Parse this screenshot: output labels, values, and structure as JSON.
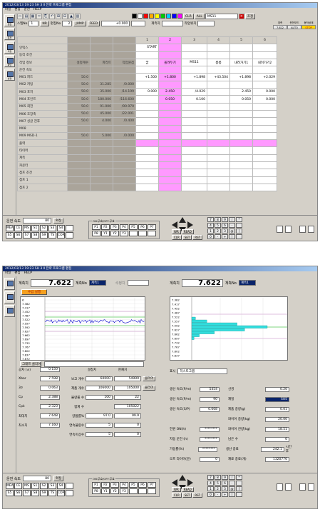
{
  "w1": {
    "title": "2012/03/13 19:23 SH 3 Ⅱ   전략 프로그램 편집",
    "menu": [
      "파일",
      "편집",
      "운전",
      "HELP"
    ],
    "side": [
      "편집",
      "운전",
      "티칭",
      "확인",
      "변경"
    ],
    "toolbar": {
      "clr": "CLR",
      "all": "ALL",
      "ms_select": "MS11",
      "confirm": "조정"
    },
    "row2": {
      "stepno_label": "스텝No",
      "stepno": "1",
      "nr": "NR",
      "pyeonjip_label": "편집No",
      "pyeonjip": "2",
      "jump": "JUMP",
      "feed": "FEED",
      "feed_val": "+0.000",
      "gyecheuk_label": "계측치",
      "jakeop_label": "작업위치"
    },
    "status": {
      "h1": "계측",
      "h2": "운전모드",
      "h3": "동작상태",
      "v1": "7.622",
      "v2": "AUTO",
      "v3": "STOP"
    },
    "left_headers": [
      "설정계수",
      "파라트",
      "작업원점"
    ],
    "col_numbers": [
      "1",
      "2",
      "3",
      "4",
      "5",
      "6"
    ],
    "rows": [
      {
        "label": "인덱스",
        "g": [
          "",
          "",
          ""
        ],
        "c": [
          "START",
          "",
          "",
          "",
          "",
          ""
        ]
      },
      {
        "label": "동작 조건",
        "g": [
          "",
          "",
          ""
        ],
        "c": [
          "",
          "",
          "",
          "",
          "",
          ""
        ]
      },
      {
        "label": "작업 정보",
        "g": [
          "설정계수",
          "파라트",
          "작업원점"
        ],
        "c": [
          "꿈",
          "올려두기",
          "MS11",
          "롱롱",
          "내려가기1",
          "내려가기2"
        ]
      },
      {
        "label": "운전 속도",
        "g": [
          "",
          "",
          ""
        ],
        "c": [
          "",
          "",
          "",
          "",
          "",
          ""
        ]
      },
      {
        "label": "M01 피드",
        "g": [
          "50.0",
          "",
          ""
        ],
        "c": [
          "+1.500",
          "+1.800",
          "+1.898",
          "+43.504",
          "+1.898",
          "+2.029"
        ]
      },
      {
        "label": "M02 커팅",
        "g": [
          "50.0",
          "31.285",
          "/0.000"
        ],
        "c": [
          "",
          "",
          "",
          "",
          "",
          ""
        ]
      },
      {
        "label": "M03 포지",
        "g": [
          "50.0",
          "35.000",
          "/14.199"
        ],
        "c": [
          "0.000",
          "2.450",
          "/4.029",
          "",
          "2.450",
          "0.000"
        ]
      },
      {
        "label": "M04 포인트",
        "g": [
          "50.0",
          "180.000",
          "/116.600"
        ],
        "c": [
          "",
          "0.050",
          "0.100",
          "",
          "0.050",
          "0.000"
        ]
      },
      {
        "label": "M05 회전",
        "g": [
          "50.0",
          "91.000",
          "/90.970"
        ],
        "c": [
          "",
          "",
          "",
          "",
          "",
          ""
        ]
      },
      {
        "label": "M06 호장축",
        "g": [
          "50.0",
          "45.000",
          "/22.001"
        ],
        "c": [
          "",
          "",
          "",
          "",
          "",
          ""
        ]
      },
      {
        "label": "M07 싱글 전후",
        "g": [
          "50.0",
          "4.000",
          "/0.400"
        ],
        "c": [
          "",
          "",
          "",
          "",
          "",
          ""
        ]
      },
      {
        "label": "M08",
        "g": [
          "",
          "",
          ""
        ],
        "c": [
          "",
          "",
          "",
          "",
          "",
          ""
        ]
      },
      {
        "label": "M09 MSD-1",
        "g": [
          "50.0",
          "5.000",
          "/0.000"
        ],
        "c": [
          "",
          "",
          "",
          "",
          "",
          ""
        ]
      },
      {
        "label": "출력",
        "g": [
          "",
          "",
          ""
        ],
        "c": [
          "",
          "",
          "",
          "",
          "",
          ""
        ]
      },
      {
        "label": "타이머",
        "g": [
          "",
          "",
          ""
        ],
        "c": [
          "",
          "",
          "",
          "",
          "",
          ""
        ]
      },
      {
        "label": "계측",
        "g": [
          "",
          "",
          ""
        ],
        "c": [
          "",
          "",
          "",
          "",
          "",
          ""
        ]
      },
      {
        "label": "카운터",
        "g": [
          "",
          "",
          ""
        ],
        "c": [
          "",
          "",
          "",
          "",
          "",
          ""
        ]
      },
      {
        "label": "점프 조건",
        "g": [
          "",
          "",
          ""
        ],
        "c": [
          "",
          "",
          "",
          "",
          "",
          ""
        ]
      },
      {
        "label": "점프 1",
        "g": [
          "",
          "",
          ""
        ],
        "c": [
          "",
          "",
          "",
          "",
          "",
          ""
        ]
      },
      {
        "label": "점프 2",
        "g": [
          "",
          "",
          ""
        ],
        "c": [
          "",
          "",
          "",
          "",
          "",
          ""
        ]
      }
    ],
    "bottom": {
      "speed_label": "운전 속도",
      "speed": "80",
      "confirm": "확정",
      "keys": [
        "MEA",
        "CE",
        "MS",
        "S1",
        "S2",
        "S3",
        "S4",
        "",
        "S5",
        "S6",
        "S7",
        "S8",
        "S9",
        "TS",
        "COR",
        ""
      ],
      "onoff_label": "ON:무효/OFF:무효",
      "okeys": [
        "P1",
        "P2",
        "P3",
        "P4",
        "P5",
        "P6",
        "P7",
        "P8",
        "Y1",
        "Y2",
        "Y3",
        "",
        "",
        ""
      ],
      "wr": "WR",
      "read": "READ",
      "clr": "CLR",
      "set": "SET",
      "rst": "RST",
      "pad": [
        "7",
        "8",
        "9",
        "/",
        "*",
        "4",
        "5",
        "6",
        "-",
        "",
        "1",
        "2",
        "3",
        "@",
        "[",
        "0",
        "-",
        "+",
        "]",
        ""
      ]
    }
  },
  "w2": {
    "title": "2012/03/13 19:23 SH 3 Ⅱ   전략 프로그램 편집",
    "menu": [
      "파일",
      "편집",
      "HELP"
    ],
    "left": {
      "label": "계측치",
      "value": "7.622",
      "gno_label": "계측No",
      "gno": "계측1",
      "sub_label": "수입 실행",
      "ctrl": "그래프 클리어",
      "ticks": [
        "6",
        "7.382",
        "7.417",
        "7.452",
        "7.487",
        "7.522",
        "7.557",
        "7.592",
        "7.627",
        "7.662",
        "7.697",
        "7.732",
        "7.767",
        "7.802",
        "7.837",
        "7.872"
      ]
    },
    "right": {
      "label": "계측치",
      "value": "7.622",
      "gno_label": "계측No",
      "gno": "계측1",
      "disp_label": "표시",
      "disp": "히스토그램",
      "ticks": [
        "7.382",
        "7.417",
        "7.452",
        "7.487",
        "7.522",
        "7.557",
        "7.592",
        "7.627",
        "7.662",
        "7.697",
        "7.732",
        "7.767",
        "7.802",
        "7.837"
      ],
      "bars": [
        0.05,
        0.2,
        0.6,
        1.0,
        0.7,
        0.3,
        0.1,
        0.03
      ]
    },
    "stats": {
      "gongcha_label": "공차 (±)",
      "gongcha": "0.150",
      "set_head": "설정치",
      "cur_head": "현재치",
      "rows": [
        {
          "l": "Xbar",
          "v": "7.598",
          "m": "보고 개수",
          "s": "60000",
          "c": "54999",
          "b": "클리어"
        },
        {
          "l": "3σ",
          "v": "0.063",
          "m": "제품 개수",
          "s": "106000",
          "c": "105000",
          "b": "클리어"
        },
        {
          "l": "Cp",
          "v": "2.388",
          "m": "불량률 수",
          "s": "100",
          "c": "22",
          "b": ""
        },
        {
          "l": "Cpk",
          "v": "2.323",
          "m": "합계 수",
          "s": "",
          "c": "105022",
          "b": ""
        },
        {
          "l": "최대치",
          "v": "7.648",
          "m": "양품률%",
          "s": "97.0",
          "c": "99.9",
          "b": ""
        },
        {
          "l": "최소치",
          "v": "7.160",
          "m": "연속불량수",
          "s": "5",
          "c": "0",
          "b": ""
        },
        {
          "l": "",
          "v": "",
          "m": "연속이상수",
          "s": "5",
          "c": "0",
          "b": ""
        }
      ]
    },
    "prod": {
      "rows": [
        {
          "l": "생산 속도(P/m)",
          "v": "5454",
          "l2": "선경",
          "v2": "0.20"
        },
        {
          "l": "생산 속도(P/m)",
          "v": "90",
          "l2": "재질",
          "v2": "SUS"
        },
        {
          "l": "생산 속도(S/P)",
          "v": "0.668",
          "l2": "제품 중량(g)",
          "v2": "0.01"
        },
        {
          "l": "",
          "v": "",
          "l2": "와이어 중량(kg)",
          "v2": "20.00"
        },
        {
          "l": "전원 ON(h)",
          "v": "********",
          "l2": "와이어 잔량(kg)",
          "v2": "18.51"
        },
        {
          "l": "자동 운전 (h)",
          "v": "********",
          "l2": "남은 수",
          "v2": "0"
        },
        {
          "l": "가동률(%)",
          "v": "********",
          "l2": "생산 종료",
          "v2": "242.1",
          "u": "시간 후"
        },
        {
          "l": "오프 타이머(분)",
          "v": "0",
          "l2": "재료 종료(개)",
          "v2": "1320776"
        }
      ]
    },
    "bottom": {
      "speed_label": "운전 속도",
      "speed": "80",
      "confirm": "확정",
      "keys": [
        "MEA",
        "CE",
        "MS",
        "S1",
        "S2",
        "S3",
        "S4",
        "",
        "S5",
        "S6",
        "S7",
        "S8",
        "S9",
        "TS",
        "COR",
        ""
      ],
      "onoff_label": "ON:무효/OFF:무효",
      "okeys": [
        "P1",
        "P2",
        "P3",
        "P4",
        "P5",
        "P6",
        "P7",
        "P8",
        "Y1",
        "Y2",
        "Y3",
        "",
        "",
        ""
      ],
      "wr": "WR",
      "read": "READ",
      "clr": "CLR",
      "set": "SET",
      "rst": "RST",
      "pad": [
        "7",
        "8",
        "9",
        "/",
        "*",
        "4",
        "5",
        "6",
        "-",
        "",
        "1",
        "2",
        "3",
        "@",
        "[",
        "0",
        "-",
        "+",
        "]",
        ""
      ]
    }
  },
  "colors": {
    "pink": "#ff99ff",
    "gray_block": "#aaa49a",
    "stop": "#ffd800",
    "hist": "#33dddd",
    "trace": "#0000cc"
  }
}
